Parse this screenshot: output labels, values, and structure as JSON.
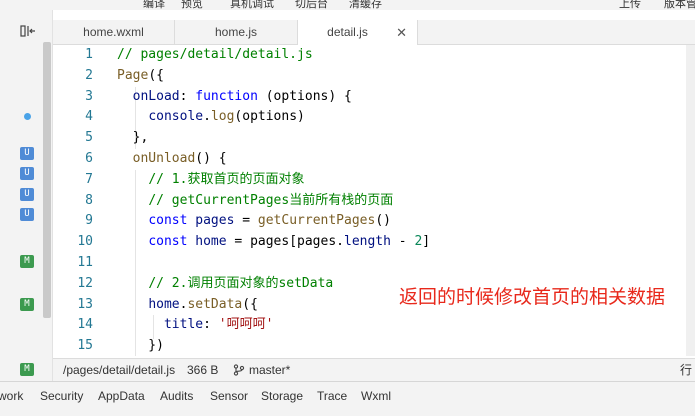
{
  "toolbar": {
    "items": [
      "编译",
      "预览",
      "真机调试",
      "切后台",
      "清缓存",
      "上传",
      "版本管"
    ]
  },
  "tabs": [
    {
      "label": "home.wxml"
    },
    {
      "label": "home.js"
    },
    {
      "label": "detail.js",
      "active": true,
      "close": "✕"
    }
  ],
  "sidebar": {
    "badges": [
      "U",
      "U",
      "U",
      "U",
      "M",
      "M",
      "M"
    ]
  },
  "editor": {
    "lines": [
      {
        "n": "1",
        "tokens": [
          [
            "c-comment",
            "// pages/detail/detail.js"
          ]
        ]
      },
      {
        "n": "2",
        "tokens": [
          [
            "c-fn",
            "Page"
          ],
          [
            "c-plain",
            "({"
          ]
        ]
      },
      {
        "n": "3",
        "tokens": [
          [
            "c-plain",
            "  "
          ],
          [
            "c-key",
            "onLoad"
          ],
          [
            "c-plain",
            ": "
          ],
          [
            "c-kw",
            "function"
          ],
          [
            "c-plain",
            " (options) {"
          ]
        ]
      },
      {
        "n": "4",
        "tokens": [
          [
            "c-plain",
            "    "
          ],
          [
            "c-var",
            "console"
          ],
          [
            "c-plain",
            "."
          ],
          [
            "c-fn",
            "log"
          ],
          [
            "c-plain",
            "(options)"
          ]
        ]
      },
      {
        "n": "5",
        "tokens": [
          [
            "c-plain",
            "  },"
          ]
        ]
      },
      {
        "n": "6",
        "tokens": [
          [
            "c-plain",
            "  "
          ],
          [
            "c-fn",
            "onUnload"
          ],
          [
            "c-plain",
            "() {"
          ]
        ]
      },
      {
        "n": "7",
        "tokens": [
          [
            "c-plain",
            "    "
          ],
          [
            "c-comment",
            "// 1.获取首页的页面对象"
          ]
        ]
      },
      {
        "n": "8",
        "tokens": [
          [
            "c-plain",
            "    "
          ],
          [
            "c-comment",
            "// getCurrentPages当前所有栈的页面"
          ]
        ]
      },
      {
        "n": "9",
        "tokens": [
          [
            "c-plain",
            "    "
          ],
          [
            "c-kw",
            "const"
          ],
          [
            "c-plain",
            " "
          ],
          [
            "c-var",
            "pages"
          ],
          [
            "c-plain",
            " = "
          ],
          [
            "c-fn",
            "getCurrentPages"
          ],
          [
            "c-plain",
            "()"
          ]
        ]
      },
      {
        "n": "10",
        "tokens": [
          [
            "c-plain",
            "    "
          ],
          [
            "c-kw",
            "const"
          ],
          [
            "c-plain",
            " "
          ],
          [
            "c-var",
            "home"
          ],
          [
            "c-plain",
            " = pages[pages."
          ],
          [
            "c-var",
            "length"
          ],
          [
            "c-plain",
            " - "
          ],
          [
            "c-num",
            "2"
          ],
          [
            "c-plain",
            "]"
          ]
        ]
      },
      {
        "n": "11",
        "tokens": []
      },
      {
        "n": "12",
        "tokens": [
          [
            "c-plain",
            "    "
          ],
          [
            "c-comment",
            "// 2.调用页面对象的setData"
          ]
        ]
      },
      {
        "n": "13",
        "tokens": [
          [
            "c-plain",
            "    "
          ],
          [
            "c-var",
            "home"
          ],
          [
            "c-plain",
            "."
          ],
          [
            "c-fn",
            "setData"
          ],
          [
            "c-plain",
            "({"
          ]
        ]
      },
      {
        "n": "14",
        "tokens": [
          [
            "c-plain",
            "      "
          ],
          [
            "c-key",
            "title"
          ],
          [
            "c-plain",
            ": "
          ],
          [
            "c-str",
            "'呵呵呵'"
          ]
        ]
      },
      {
        "n": "15",
        "tokens": [
          [
            "c-plain",
            "    })"
          ]
        ]
      }
    ],
    "annotation": "返回的时候修改首页的相关数据"
  },
  "statusbar": {
    "path": "/pages/detail/detail.js",
    "size": "366 B",
    "branch": "master*",
    "right": "行"
  },
  "devtools": {
    "tabs": [
      "work",
      "Security",
      "AppData",
      "Audits",
      "Sensor",
      "Storage",
      "Trace",
      "Wxml"
    ]
  },
  "colors": {
    "annotation": "#e8281b",
    "comment": "#008000",
    "keyword": "#0000ff",
    "badge_u": "#4f8bd6",
    "badge_m": "#3c9a4f"
  }
}
